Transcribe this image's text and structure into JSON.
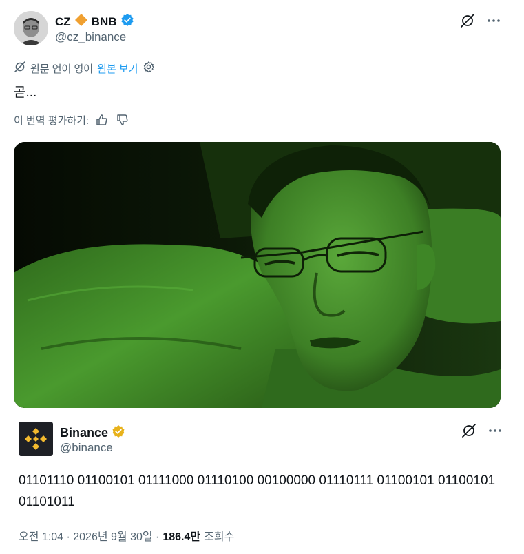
{
  "post": {
    "display_name": "CZ",
    "name_suffix": "BNB",
    "handle": "@cz_binance",
    "translate": {
      "label": "원문 언어 영어",
      "link": "원본 보기"
    },
    "text": "곧...",
    "rate": {
      "label": "이 번역 평가하기:"
    },
    "icons": {
      "grok": "grok-icon",
      "more": "more-icon",
      "verified": "verified-badge-icon",
      "diamond": "bnb-diamond-icon"
    },
    "colors": {
      "accent": "#1d9bf0",
      "bnb": "#f3ba2f",
      "photo_tint": "#3f8f2a"
    }
  },
  "quoted": {
    "display_name": "Binance",
    "handle": "@binance",
    "text": "01101110 01100101 01111000 01110100 00100000 01110111 01100101 01100101 01101011",
    "badge": "gold-verified-badge-icon"
  },
  "meta": {
    "time": "오전 1:04 · 2026년 9월 30일 ·",
    "views": "186.4만",
    "views_label": "조회수"
  }
}
